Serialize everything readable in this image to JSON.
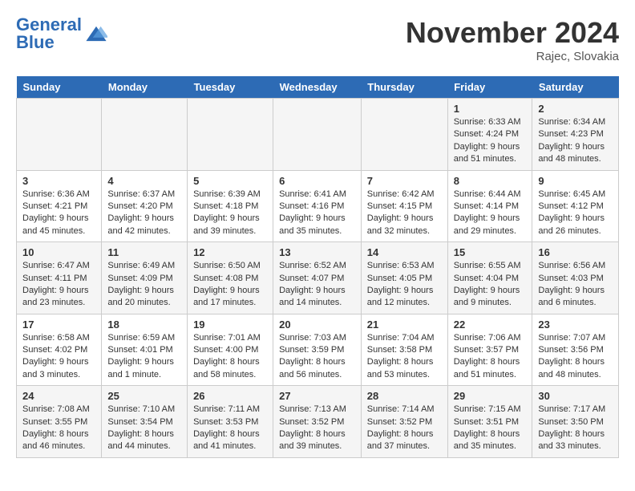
{
  "header": {
    "logo_general": "General",
    "logo_blue": "Blue",
    "month_title": "November 2024",
    "location": "Rajec, Slovakia"
  },
  "weekdays": [
    "Sunday",
    "Monday",
    "Tuesday",
    "Wednesday",
    "Thursday",
    "Friday",
    "Saturday"
  ],
  "weeks": [
    [
      {
        "num": "",
        "info": ""
      },
      {
        "num": "",
        "info": ""
      },
      {
        "num": "",
        "info": ""
      },
      {
        "num": "",
        "info": ""
      },
      {
        "num": "",
        "info": ""
      },
      {
        "num": "1",
        "info": "Sunrise: 6:33 AM\nSunset: 4:24 PM\nDaylight: 9 hours and 51 minutes."
      },
      {
        "num": "2",
        "info": "Sunrise: 6:34 AM\nSunset: 4:23 PM\nDaylight: 9 hours and 48 minutes."
      }
    ],
    [
      {
        "num": "3",
        "info": "Sunrise: 6:36 AM\nSunset: 4:21 PM\nDaylight: 9 hours and 45 minutes."
      },
      {
        "num": "4",
        "info": "Sunrise: 6:37 AM\nSunset: 4:20 PM\nDaylight: 9 hours and 42 minutes."
      },
      {
        "num": "5",
        "info": "Sunrise: 6:39 AM\nSunset: 4:18 PM\nDaylight: 9 hours and 39 minutes."
      },
      {
        "num": "6",
        "info": "Sunrise: 6:41 AM\nSunset: 4:16 PM\nDaylight: 9 hours and 35 minutes."
      },
      {
        "num": "7",
        "info": "Sunrise: 6:42 AM\nSunset: 4:15 PM\nDaylight: 9 hours and 32 minutes."
      },
      {
        "num": "8",
        "info": "Sunrise: 6:44 AM\nSunset: 4:14 PM\nDaylight: 9 hours and 29 minutes."
      },
      {
        "num": "9",
        "info": "Sunrise: 6:45 AM\nSunset: 4:12 PM\nDaylight: 9 hours and 26 minutes."
      }
    ],
    [
      {
        "num": "10",
        "info": "Sunrise: 6:47 AM\nSunset: 4:11 PM\nDaylight: 9 hours and 23 minutes."
      },
      {
        "num": "11",
        "info": "Sunrise: 6:49 AM\nSunset: 4:09 PM\nDaylight: 9 hours and 20 minutes."
      },
      {
        "num": "12",
        "info": "Sunrise: 6:50 AM\nSunset: 4:08 PM\nDaylight: 9 hours and 17 minutes."
      },
      {
        "num": "13",
        "info": "Sunrise: 6:52 AM\nSunset: 4:07 PM\nDaylight: 9 hours and 14 minutes."
      },
      {
        "num": "14",
        "info": "Sunrise: 6:53 AM\nSunset: 4:05 PM\nDaylight: 9 hours and 12 minutes."
      },
      {
        "num": "15",
        "info": "Sunrise: 6:55 AM\nSunset: 4:04 PM\nDaylight: 9 hours and 9 minutes."
      },
      {
        "num": "16",
        "info": "Sunrise: 6:56 AM\nSunset: 4:03 PM\nDaylight: 9 hours and 6 minutes."
      }
    ],
    [
      {
        "num": "17",
        "info": "Sunrise: 6:58 AM\nSunset: 4:02 PM\nDaylight: 9 hours and 3 minutes."
      },
      {
        "num": "18",
        "info": "Sunrise: 6:59 AM\nSunset: 4:01 PM\nDaylight: 9 hours and 1 minute."
      },
      {
        "num": "19",
        "info": "Sunrise: 7:01 AM\nSunset: 4:00 PM\nDaylight: 8 hours and 58 minutes."
      },
      {
        "num": "20",
        "info": "Sunrise: 7:03 AM\nSunset: 3:59 PM\nDaylight: 8 hours and 56 minutes."
      },
      {
        "num": "21",
        "info": "Sunrise: 7:04 AM\nSunset: 3:58 PM\nDaylight: 8 hours and 53 minutes."
      },
      {
        "num": "22",
        "info": "Sunrise: 7:06 AM\nSunset: 3:57 PM\nDaylight: 8 hours and 51 minutes."
      },
      {
        "num": "23",
        "info": "Sunrise: 7:07 AM\nSunset: 3:56 PM\nDaylight: 8 hours and 48 minutes."
      }
    ],
    [
      {
        "num": "24",
        "info": "Sunrise: 7:08 AM\nSunset: 3:55 PM\nDaylight: 8 hours and 46 minutes."
      },
      {
        "num": "25",
        "info": "Sunrise: 7:10 AM\nSunset: 3:54 PM\nDaylight: 8 hours and 44 minutes."
      },
      {
        "num": "26",
        "info": "Sunrise: 7:11 AM\nSunset: 3:53 PM\nDaylight: 8 hours and 41 minutes."
      },
      {
        "num": "27",
        "info": "Sunrise: 7:13 AM\nSunset: 3:52 PM\nDaylight: 8 hours and 39 minutes."
      },
      {
        "num": "28",
        "info": "Sunrise: 7:14 AM\nSunset: 3:52 PM\nDaylight: 8 hours and 37 minutes."
      },
      {
        "num": "29",
        "info": "Sunrise: 7:15 AM\nSunset: 3:51 PM\nDaylight: 8 hours and 35 minutes."
      },
      {
        "num": "30",
        "info": "Sunrise: 7:17 AM\nSunset: 3:50 PM\nDaylight: 8 hours and 33 minutes."
      }
    ]
  ]
}
